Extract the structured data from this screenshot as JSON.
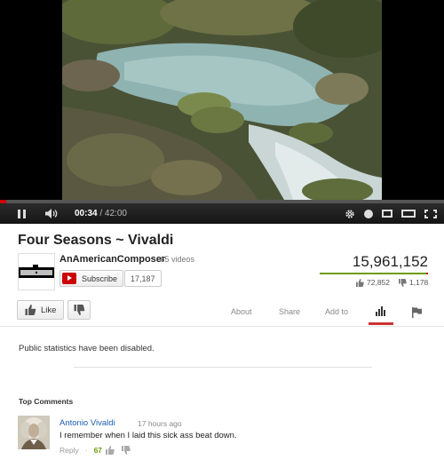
{
  "player": {
    "current_time": "00:34",
    "duration": "42:00",
    "progress_fraction": 0.0135
  },
  "video": {
    "title": "Four Seasons ~ Vivaldi",
    "views": "15,961,152",
    "likes": "72,852",
    "dislikes": "1,178",
    "like_fraction": 0.984
  },
  "channel": {
    "name": "AnAmericanComposer",
    "video_count": "· 65 videos",
    "subscribe_label": "Subscribe",
    "subscriber_count": "17,187"
  },
  "actions": {
    "like_label": "Like",
    "tabs": [
      "About",
      "Share",
      "Add to"
    ]
  },
  "stats_message": "Public statistics have been disabled.",
  "comments": {
    "heading": "Top Comments",
    "items": [
      {
        "author": "Antonio Vivaldi",
        "time": "17 hours ago",
        "text": "I remember when I laid this sick ass beat down.",
        "reply_label": "Reply",
        "likes": "67"
      }
    ]
  },
  "colors": {
    "brand_red": "#cc0000",
    "like_green": "#6b9d0e",
    "link_blue": "#1b5fb0"
  }
}
